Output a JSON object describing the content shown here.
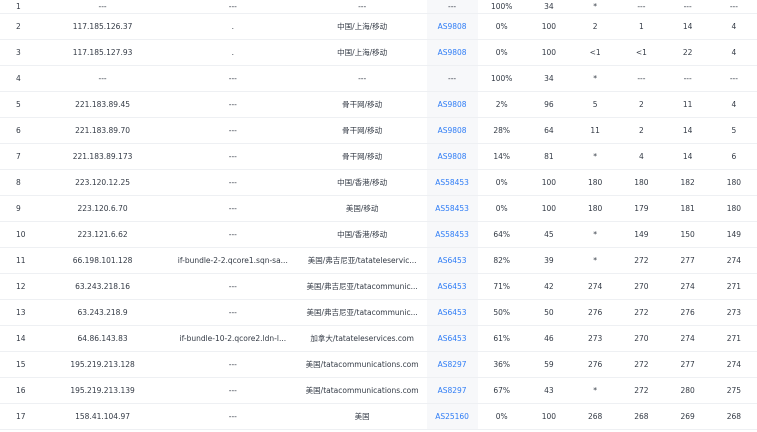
{
  "rows": [
    {
      "hop": "1",
      "ip": "---",
      "host": "---",
      "loc": "---",
      "asn": "---",
      "loss": "100%",
      "sent": "34",
      "last": "*",
      "avg": "---",
      "best": "---",
      "worst": "---"
    },
    {
      "hop": "2",
      "ip": "117.185.126.37",
      "host": ".",
      "loc": "中国/上海/移动",
      "asn": "AS9808",
      "loss": "0%",
      "sent": "100",
      "last": "2",
      "avg": "1",
      "best": "14",
      "worst": "4"
    },
    {
      "hop": "3",
      "ip": "117.185.127.93",
      "host": ".",
      "loc": "中国/上海/移动",
      "asn": "AS9808",
      "loss": "0%",
      "sent": "100",
      "last": "<1",
      "avg": "<1",
      "best": "22",
      "worst": "4"
    },
    {
      "hop": "4",
      "ip": "---",
      "host": "---",
      "loc": "---",
      "asn": "---",
      "loss": "100%",
      "sent": "34",
      "last": "*",
      "avg": "---",
      "best": "---",
      "worst": "---"
    },
    {
      "hop": "5",
      "ip": "221.183.89.45",
      "host": "---",
      "loc": "骨干网/移动",
      "asn": "AS9808",
      "loss": "2%",
      "sent": "96",
      "last": "5",
      "avg": "2",
      "best": "11",
      "worst": "4"
    },
    {
      "hop": "6",
      "ip": "221.183.89.70",
      "host": "---",
      "loc": "骨干网/移动",
      "asn": "AS9808",
      "loss": "28%",
      "sent": "64",
      "last": "11",
      "avg": "2",
      "best": "14",
      "worst": "5"
    },
    {
      "hop": "7",
      "ip": "221.183.89.173",
      "host": "---",
      "loc": "骨干网/移动",
      "asn": "AS9808",
      "loss": "14%",
      "sent": "81",
      "last": "*",
      "avg": "4",
      "best": "14",
      "worst": "6"
    },
    {
      "hop": "8",
      "ip": "223.120.12.25",
      "host": "---",
      "loc": "中国/香港/移动",
      "asn": "AS58453",
      "loss": "0%",
      "sent": "100",
      "last": "180",
      "avg": "180",
      "best": "182",
      "worst": "180"
    },
    {
      "hop": "9",
      "ip": "223.120.6.70",
      "host": "---",
      "loc": "美国/移动",
      "asn": "AS58453",
      "loss": "0%",
      "sent": "100",
      "last": "180",
      "avg": "179",
      "best": "181",
      "worst": "180"
    },
    {
      "hop": "10",
      "ip": "223.121.6.62",
      "host": "---",
      "loc": "中国/香港/移动",
      "asn": "AS58453",
      "loss": "64%",
      "sent": "45",
      "last": "*",
      "avg": "149",
      "best": "150",
      "worst": "149"
    },
    {
      "hop": "11",
      "ip": "66.198.101.128",
      "host": "if-bundle-2-2.qcore1.sqn-sa...",
      "loc": "美国/弗吉尼亚/tatateleservic...",
      "asn": "AS6453",
      "loss": "82%",
      "sent": "39",
      "last": "*",
      "avg": "272",
      "best": "277",
      "worst": "274"
    },
    {
      "hop": "12",
      "ip": "63.243.218.16",
      "host": "---",
      "loc": "美国/弗吉尼亚/tatacommunic...",
      "asn": "AS6453",
      "loss": "71%",
      "sent": "42",
      "last": "274",
      "avg": "270",
      "best": "274",
      "worst": "271"
    },
    {
      "hop": "13",
      "ip": "63.243.218.9",
      "host": "---",
      "loc": "美国/弗吉尼亚/tatacommunic...",
      "asn": "AS6453",
      "loss": "50%",
      "sent": "50",
      "last": "276",
      "avg": "272",
      "best": "276",
      "worst": "273"
    },
    {
      "hop": "14",
      "ip": "64.86.143.83",
      "host": "if-bundle-10-2.qcore2.ldn-l...",
      "loc": "加拿大/tatateleservices.com",
      "asn": "AS6453",
      "loss": "61%",
      "sent": "46",
      "last": "273",
      "avg": "270",
      "best": "274",
      "worst": "271"
    },
    {
      "hop": "15",
      "ip": "195.219.213.128",
      "host": "---",
      "loc": "美国/tatacommunications.com",
      "asn": "AS8297",
      "loss": "36%",
      "sent": "59",
      "last": "276",
      "avg": "272",
      "best": "277",
      "worst": "274"
    },
    {
      "hop": "16",
      "ip": "195.219.213.139",
      "host": "---",
      "loc": "美国/tatacommunications.com",
      "asn": "AS8297",
      "loss": "67%",
      "sent": "43",
      "last": "*",
      "avg": "272",
      "best": "280",
      "worst": "275"
    },
    {
      "hop": "17",
      "ip": "158.41.104.97",
      "host": "---",
      "loc": "美国",
      "asn": "AS25160",
      "loss": "0%",
      "sent": "100",
      "last": "268",
      "avg": "268",
      "best": "269",
      "worst": "268"
    }
  ],
  "colors": {
    "asn_link": "#2f7df6",
    "asn_bg": "#f7f8fa",
    "text": "#333a45",
    "divider": "#eef0f3"
  }
}
